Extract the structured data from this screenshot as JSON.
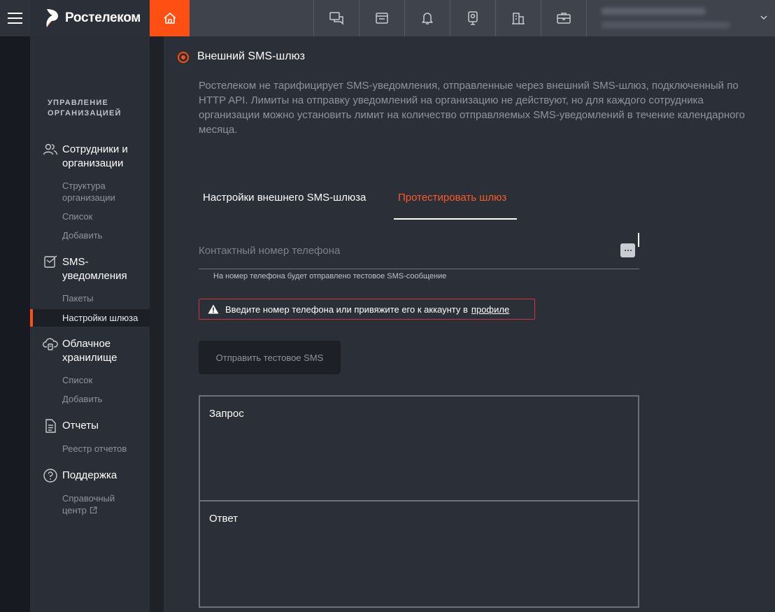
{
  "header": {
    "brand": "Ростелеком",
    "nav_icons": [
      "chat-icon",
      "calendar-icon",
      "bell-icon",
      "camera-icon",
      "building-icon",
      "briefcase-icon"
    ],
    "accent": "#ff4f12"
  },
  "sidebar": {
    "section_title_1": "УПРАВЛЕНИЕ",
    "section_title_2": "ОРГАНИЗАЦИЕЙ",
    "groups": [
      {
        "label_1": "Сотрудники и",
        "label_2": "организации",
        "icon": "users-icon",
        "items": [
          "Структура организации",
          "Список",
          "Добавить"
        ]
      },
      {
        "label_1": "SMS-",
        "label_2": "уведомления",
        "icon": "sms-icon",
        "items": [
          "Пакеты",
          "Настройки шлюза"
        ]
      },
      {
        "label_1": "Облачное",
        "label_2": "хранилище",
        "icon": "cloud-icon",
        "items": [
          "Список",
          "Добавить"
        ]
      },
      {
        "label_1": "Отчеты",
        "icon": "report-icon",
        "items": [
          "Реестр отчетов"
        ]
      },
      {
        "label_1": "Поддержка",
        "icon": "help-icon",
        "items": [
          "Справочный центр"
        ]
      }
    ],
    "struct_1": "Структура",
    "struct_2": "организации",
    "help_1": "Справочный",
    "help_2": "центр",
    "active_item": "Настройки шлюза"
  },
  "main": {
    "heading": "Внешний SMS-шлюз",
    "description": "Ростелеком не тарифицирует SMS-уведомления, отправленные через внешний SMS-шлюз, подключенный по HTTP API. Лимиты на отправку уведомлений на организацию не действуют, но для каждого сотрудника организации можно установить лимит на количество отправляемых SMS-уведомлений в течение календарного месяца.",
    "tabs": [
      {
        "label": "Настройки внешнего SMS-шлюза",
        "active": false
      },
      {
        "label": "Протестировать шлюз",
        "active": true
      }
    ],
    "phone": {
      "placeholder": "Контактный номер телефона",
      "value": "",
      "hint": "На номер телефона будет отправлено тестовое SMS-сообщение"
    },
    "alert": {
      "text": "Введите номер телефона или привяжите его к аккаунту в",
      "link": "профиле",
      "border_color": "#d2343a"
    },
    "send_button": "Отправить тестовое SMS",
    "request_label": "Запрос",
    "response_label": "Ответ"
  }
}
